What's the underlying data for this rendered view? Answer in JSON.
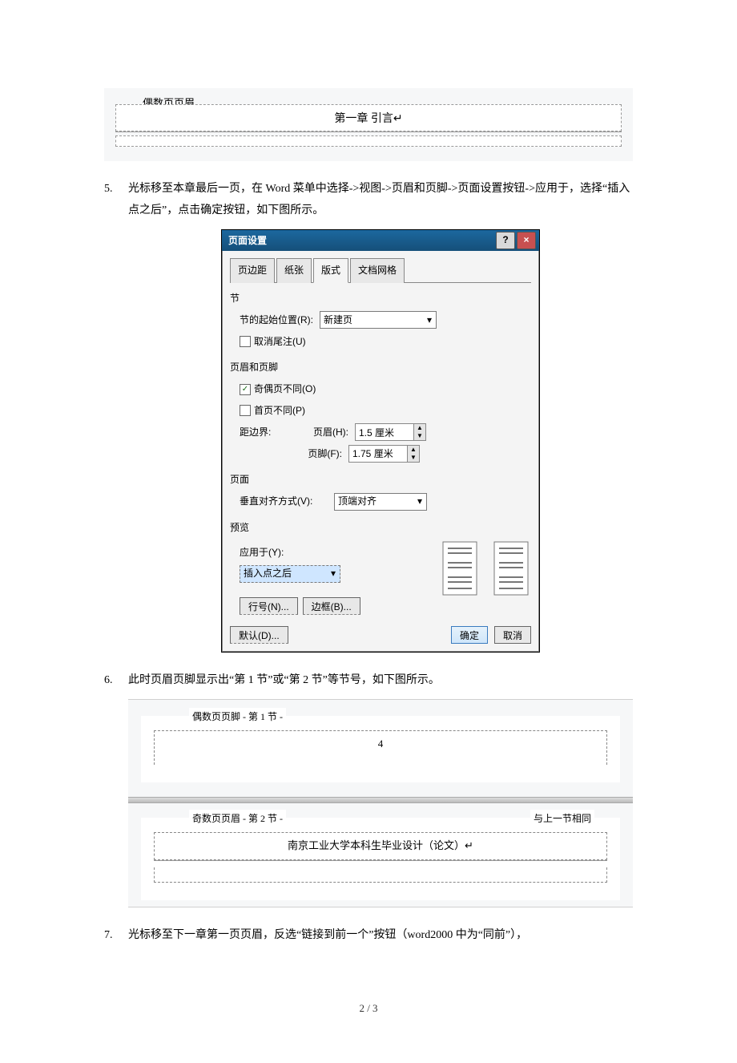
{
  "fig1": {
    "tag": "偶数页页眉",
    "center": "第一章 引言↵"
  },
  "step5": {
    "num": "5.",
    "text": "光标移至本章最后一页，在 Word 菜单中选择->视图->页眉和页脚->页面设置按钮->应用于，选择“插入点之后”，点击确定按钮，如下图所示。"
  },
  "dialog": {
    "title": "页面设置",
    "help": "?",
    "close": "×",
    "tabs": {
      "margin": "页边距",
      "paper": "纸张",
      "layout": "版式",
      "grid": "文档网格"
    },
    "section": {
      "title": "节",
      "start_label": "节的起始位置(R):",
      "start_value": "新建页",
      "endnote_label": "取消尾注(U)"
    },
    "hf": {
      "title": "页眉和页脚",
      "odd_even": "奇偶页不同(O)",
      "first_diff": "首页不同(P)",
      "edge_label": "距边界:",
      "header_label": "页眉(H):",
      "header_value": "1.5 厘米",
      "footer_label": "页脚(F):",
      "footer_value": "1.75 厘米"
    },
    "page": {
      "title": "页面",
      "valign_label": "垂直对齐方式(V):",
      "valign_value": "顶端对齐"
    },
    "preview": {
      "title": "预览",
      "apply_label": "应用于(Y):",
      "apply_value": "插入点之后",
      "lineno": "行号(N)...",
      "border": "边框(B)..."
    },
    "buttons": {
      "defaults": "默认(D)...",
      "ok": "确定",
      "cancel": "取消"
    }
  },
  "step6": {
    "num": "6.",
    "text": "此时页眉页脚显示出“第 1 节”或“第 2 节”等节号，如下图所示。"
  },
  "fig2": {
    "tag_even": "偶数页页脚 - 第 1 节 -",
    "page4": "4",
    "tag_odd": "奇数页页眉 - 第 2 节 -",
    "same": "与上一节相同",
    "header_text": "南京工业大学本科生毕业设计（论文）↵"
  },
  "step7": {
    "num": "7.",
    "text": "光标移至下一章第一页页眉，反选“链接到前一个”按钮（word2000 中为“同前”），"
  },
  "footer": "2 / 3"
}
